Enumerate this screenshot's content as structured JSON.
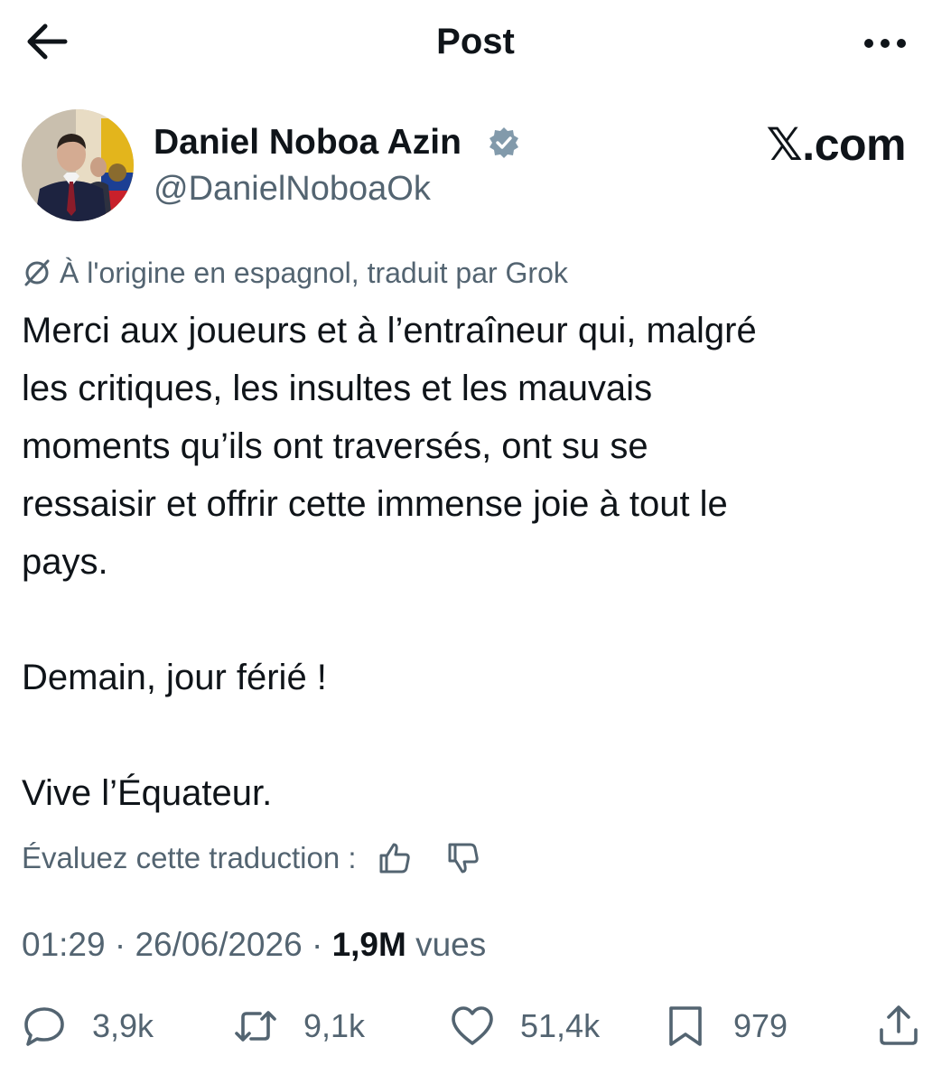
{
  "header": {
    "title": "Post",
    "back_icon": "arrow-left-icon",
    "more_icon": "more-horizontal-icon"
  },
  "author": {
    "name": "Daniel Noboa Azin",
    "handle": "@DanielNoboaOk",
    "verified_icon": "verified-badge-icon",
    "avatar": "profile-photo"
  },
  "site_label": "𝕏.com",
  "translation": {
    "icon": "grok-slash-icon",
    "note": "À l'origine en espagnol, traduit par Grok"
  },
  "post": {
    "text": "Merci aux joueurs et à l’entraîneur qui, malgré\nles critiques, les insultes et les mauvais\nmoments qu’ils ont traversés, ont su se\nressaisir et offrir cette immense joie à tout le\npays.\n\nDemain, jour férié !\n\nVive l’Équateur."
  },
  "rating": {
    "label": "Évaluez cette traduction :",
    "thumbs_up_icon": "thumbs-up-icon",
    "thumbs_down_icon": "thumbs-down-icon"
  },
  "meta": {
    "time": "01:29",
    "separator": "·",
    "date": "26/06/2026",
    "views_count": "1,9M",
    "views_label": "vues"
  },
  "actions": {
    "replies": "3,9k",
    "reposts": "9,1k",
    "likes": "51,4k",
    "bookmarks": "979"
  },
  "colors": {
    "text": "#0f1419",
    "secondary": "#536471",
    "verified": "#829aab"
  }
}
